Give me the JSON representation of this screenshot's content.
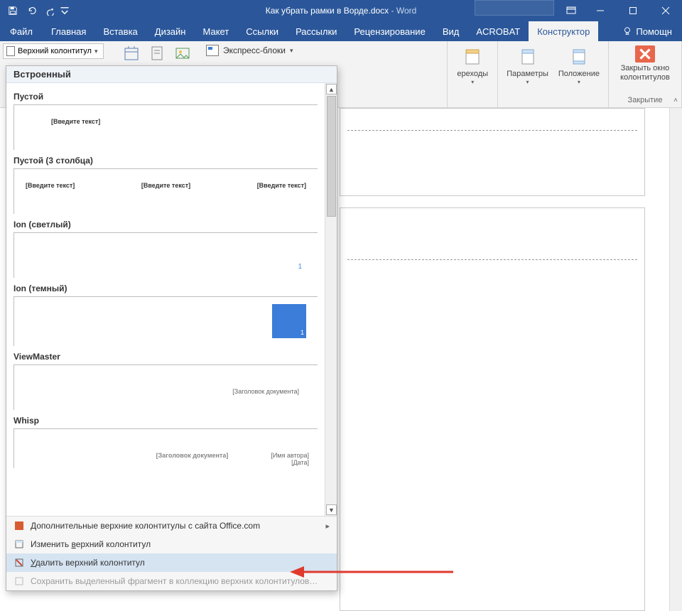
{
  "window": {
    "doc_title": "Как убрать рамки в Ворде.docx",
    "app_suffix": " - Word"
  },
  "tabs": {
    "file": "Файл",
    "home": "Главная",
    "insert": "Вставка",
    "design": "Дизайн",
    "layout": "Макет",
    "references": "Ссылки",
    "mailings": "Рассылки",
    "review": "Рецензирование",
    "view": "Вид",
    "acrobat": "ACROBAT",
    "designer": "Конструктор",
    "help": "Помощн"
  },
  "ribbon": {
    "header_btn": "Верхний колонтитул",
    "express": "Экспресс-блоки",
    "transitions": "ереходы",
    "options": "Параметры",
    "position": "Положение",
    "close_hf_line1": "Закрыть окно",
    "close_hf_line2": "колонтитулов",
    "close_group": "Закрытие"
  },
  "gallery": {
    "header": "Встроенный",
    "items": [
      {
        "name": "Пустой",
        "ph1": "[Введите текст]"
      },
      {
        "name": "Пустой (3 столбца)",
        "ph1": "[Введите текст]",
        "ph2": "[Введите текст]",
        "ph3": "[Введите текст]"
      },
      {
        "name": "Ion (светлый)",
        "num": "1"
      },
      {
        "name": "Ion (темный)",
        "num": "1"
      },
      {
        "name": "ViewMaster",
        "ph1": "[Заголовок документа]"
      },
      {
        "name": "Whisp",
        "ph1": "[Заголовок документа]",
        "ph2": "[Имя автора]",
        "ph3": "[Дата]"
      }
    ],
    "footer": {
      "more": "Дополнительные верхние колонтитулы с сайта Office.com",
      "edit_pre": "Изменить ",
      "edit_u": "в",
      "edit_post": "ерхний колонтитул",
      "remove_pre": "",
      "remove_u": "У",
      "remove_post": "далить верхний колонтитул",
      "save": "Сохранить выделенный фрагмент в коллекцию верхних колонтитулов…"
    }
  }
}
